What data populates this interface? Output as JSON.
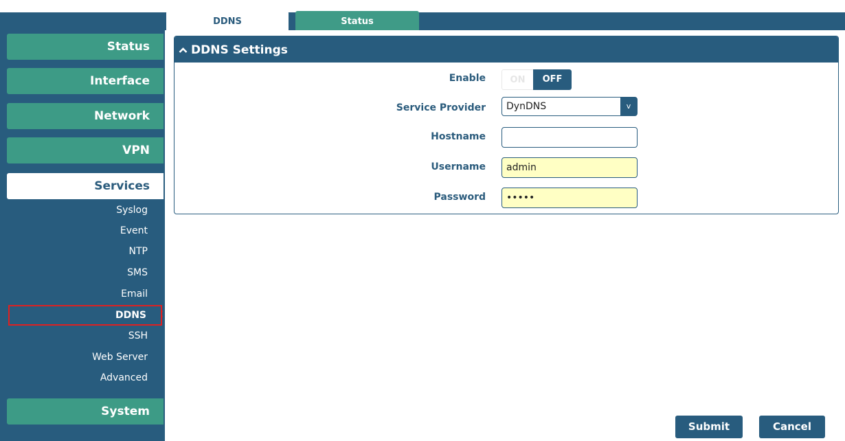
{
  "tabs": [
    {
      "label": "DDNS"
    },
    {
      "label": "Status"
    }
  ],
  "sidebar": {
    "main": [
      {
        "label": "Status"
      },
      {
        "label": "Interface"
      },
      {
        "label": "Network"
      },
      {
        "label": "VPN"
      },
      {
        "label": "Services"
      },
      {
        "label": "System"
      }
    ],
    "sub": [
      {
        "label": "Syslog"
      },
      {
        "label": "Event"
      },
      {
        "label": "NTP"
      },
      {
        "label": "SMS"
      },
      {
        "label": "Email"
      },
      {
        "label": "DDNS"
      },
      {
        "label": "SSH"
      },
      {
        "label": "Web Server"
      },
      {
        "label": "Advanced"
      }
    ]
  },
  "panel": {
    "title": "DDNS Settings",
    "enable": {
      "label": "Enable",
      "on_label": "ON",
      "off_label": "OFF",
      "state": "OFF"
    },
    "service_provider": {
      "label": "Service Provider",
      "value": "DynDNS",
      "arrow": "v"
    },
    "hostname": {
      "label": "Hostname",
      "value": ""
    },
    "username": {
      "label": "Username",
      "value": "admin"
    },
    "password": {
      "label": "Password",
      "value": "•••••"
    }
  },
  "buttons": {
    "submit": "Submit",
    "cancel": "Cancel"
  },
  "colors": {
    "navy": "#285c7e",
    "teal": "#3d9b86",
    "highlight_border": "#e02020",
    "autofill_yellow": "#ffffc4"
  }
}
